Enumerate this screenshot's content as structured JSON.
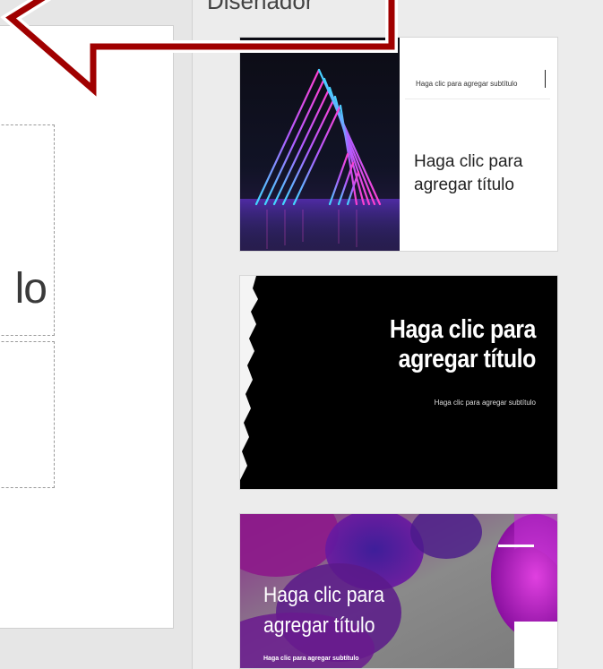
{
  "designer": {
    "heading": "Diseñador"
  },
  "slide": {
    "title_fragment": "lo"
  },
  "designs": [
    {
      "subtitle": "Haga clic para agregar subtítulo",
      "title": "Haga clic para agregar título"
    },
    {
      "title": "Haga clic para agregar título",
      "subtitle": "Haga clic para agregar subtítulo"
    },
    {
      "title": "Haga clic para agregar título",
      "subtitle": "Haga clic para agregar subtítulo"
    }
  ],
  "colors": {
    "callout_arrow": "#a00000",
    "neon_pink": "#ff3fd0",
    "neon_cyan": "#3fd8ff",
    "purple": "#7a1a9a"
  }
}
